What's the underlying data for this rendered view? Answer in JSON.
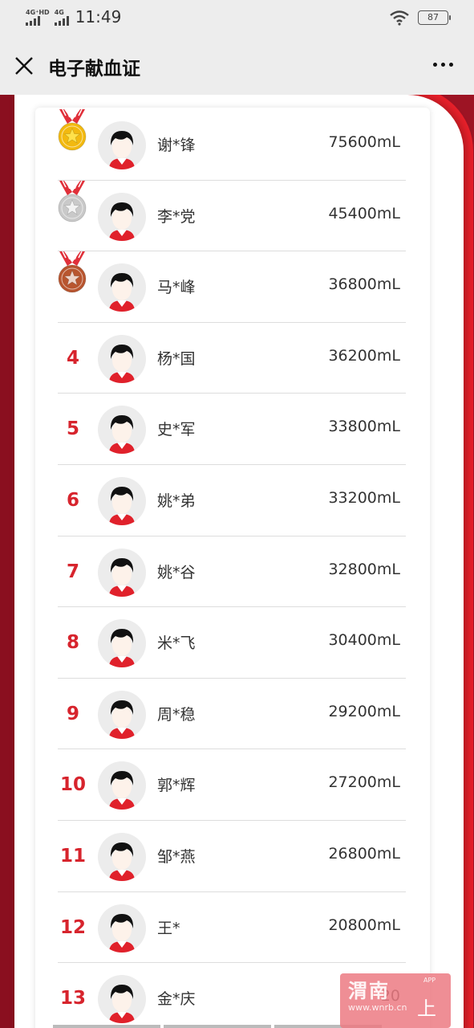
{
  "status_bar": {
    "signal1_label": "4G⁺HD",
    "signal2_label": "4G",
    "time": "11:49",
    "battery": "87"
  },
  "header": {
    "title": "电子献血证"
  },
  "ranking": [
    {
      "rank": "1",
      "medal": "gold",
      "name": "谢*锋",
      "amount": "75600mL"
    },
    {
      "rank": "2",
      "medal": "silver",
      "name": "李*党",
      "amount": "45400mL"
    },
    {
      "rank": "3",
      "medal": "bronze",
      "name": "马*峰",
      "amount": "36800mL"
    },
    {
      "rank": "4",
      "name": "杨*国",
      "amount": "36200mL"
    },
    {
      "rank": "5",
      "name": "史*军",
      "amount": "33800mL"
    },
    {
      "rank": "6",
      "name": "姚*弟",
      "amount": "33200mL"
    },
    {
      "rank": "7",
      "name": "姚*谷",
      "amount": "32800mL"
    },
    {
      "rank": "8",
      "name": "米*飞",
      "amount": "30400mL"
    },
    {
      "rank": "9",
      "name": "周*稳",
      "amount": "29200mL"
    },
    {
      "rank": "10",
      "name": "郭*辉",
      "amount": "27200mL"
    },
    {
      "rank": "11",
      "name": "邹*燕",
      "amount": "26800mL"
    },
    {
      "rank": "12",
      "name": "王*",
      "amount": "20800mL"
    },
    {
      "rank": "13",
      "name": "金*庆",
      "amount": "20"
    }
  ],
  "watermark": {
    "brand": "渭南",
    "app": "APP",
    "url": "www.wnrb.cn",
    "button_label": "上一步"
  },
  "colors": {
    "rank_red": "#d7242d",
    "background_red": "#9d1424",
    "accent_red": "#e8202a",
    "gold": "#f2b90f",
    "silver": "#c9c9c9",
    "bronze": "#b8552f"
  }
}
